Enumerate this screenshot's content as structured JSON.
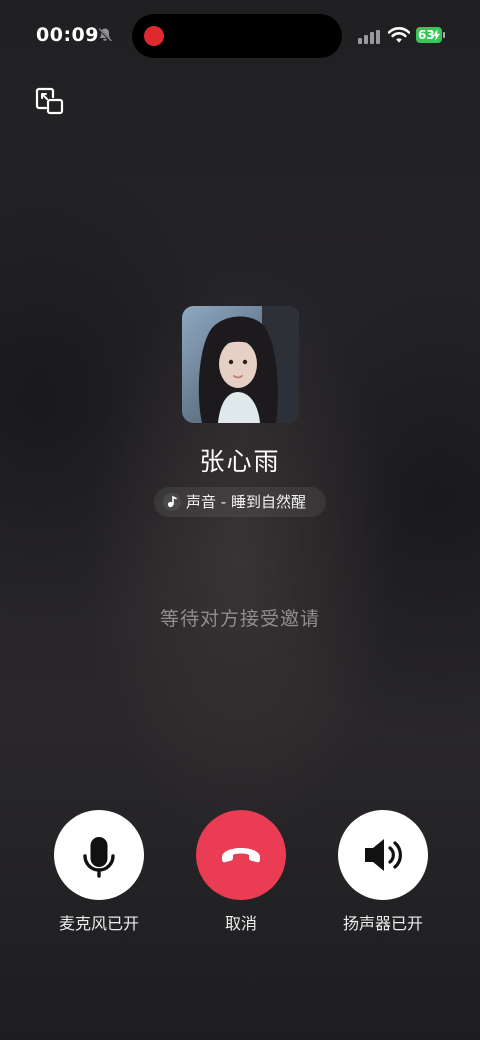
{
  "status_bar": {
    "time": "00:09",
    "battery": "63"
  },
  "call": {
    "contact_name": "张心雨",
    "music_status": "声音 - 睡到自然醒",
    "waiting_text": "等待对方接受邀请"
  },
  "controls": {
    "mic_label": "麦克风已开",
    "cancel_label": "取消",
    "speaker_label": "扬声器已开"
  },
  "icons": {
    "bell": "bell-muted-icon",
    "minimize": "minimize-window-icon",
    "mic": "microphone-icon",
    "hangup": "phone-hangup-icon",
    "speaker": "speaker-icon"
  },
  "colors": {
    "hangup_red": "#ea3c53",
    "battery_green": "#34c759",
    "record_red": "#e0292f"
  }
}
